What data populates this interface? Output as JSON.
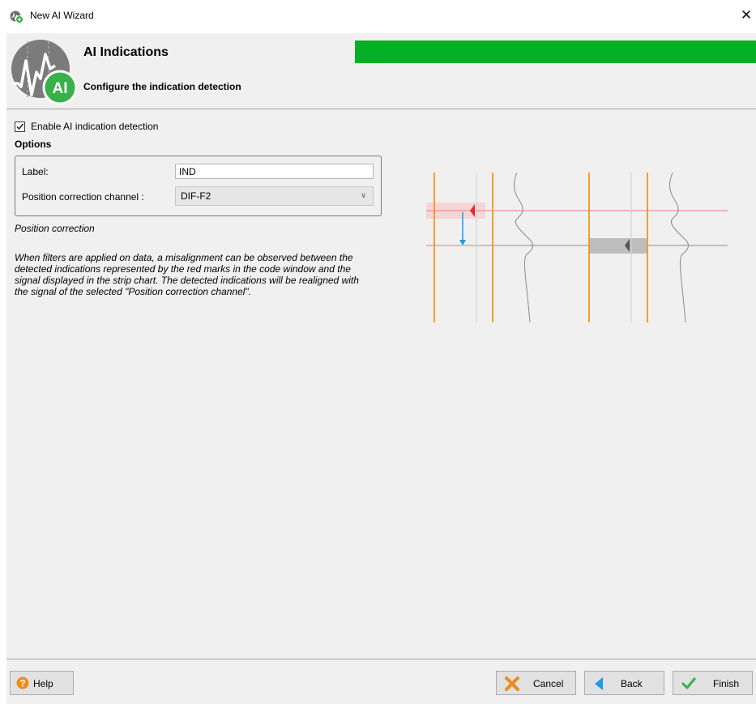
{
  "window": {
    "title": "New AI Wizard",
    "close_glyph": "✕"
  },
  "header": {
    "title": "AI Indications",
    "subtitle": "Configure the indication detection",
    "logo_text": "AI",
    "progress_percent": 100,
    "progress_color": "#06b025"
  },
  "content": {
    "enable_label": "Enable AI indication detection",
    "enable_checked": true,
    "options_title": "Options",
    "label_field_label": "Label:",
    "label_field_value": "IND",
    "position_channel_label": "Position correction channel :",
    "position_channel_value": "DIF-F2",
    "position_correction_title": "Position correction",
    "position_correction_text": "When filters are applied on data, a misalignment can be observed between the detected indications represented by the red marks in the code window and the signal displayed in the strip chart. The detected indications will be realigned with the signal of the selected \"Position correction channel\"."
  },
  "footer": {
    "help_label": "Help",
    "cancel_label": "Cancel",
    "back_label": "Back",
    "finish_label": "Finish"
  },
  "colors": {
    "accent_orange": "#f7941d",
    "marker_red": "#e8262d",
    "arrow_blue": "#1e9be9",
    "logo_green": "#3ab04a",
    "help_orange": "#f08a1c"
  }
}
